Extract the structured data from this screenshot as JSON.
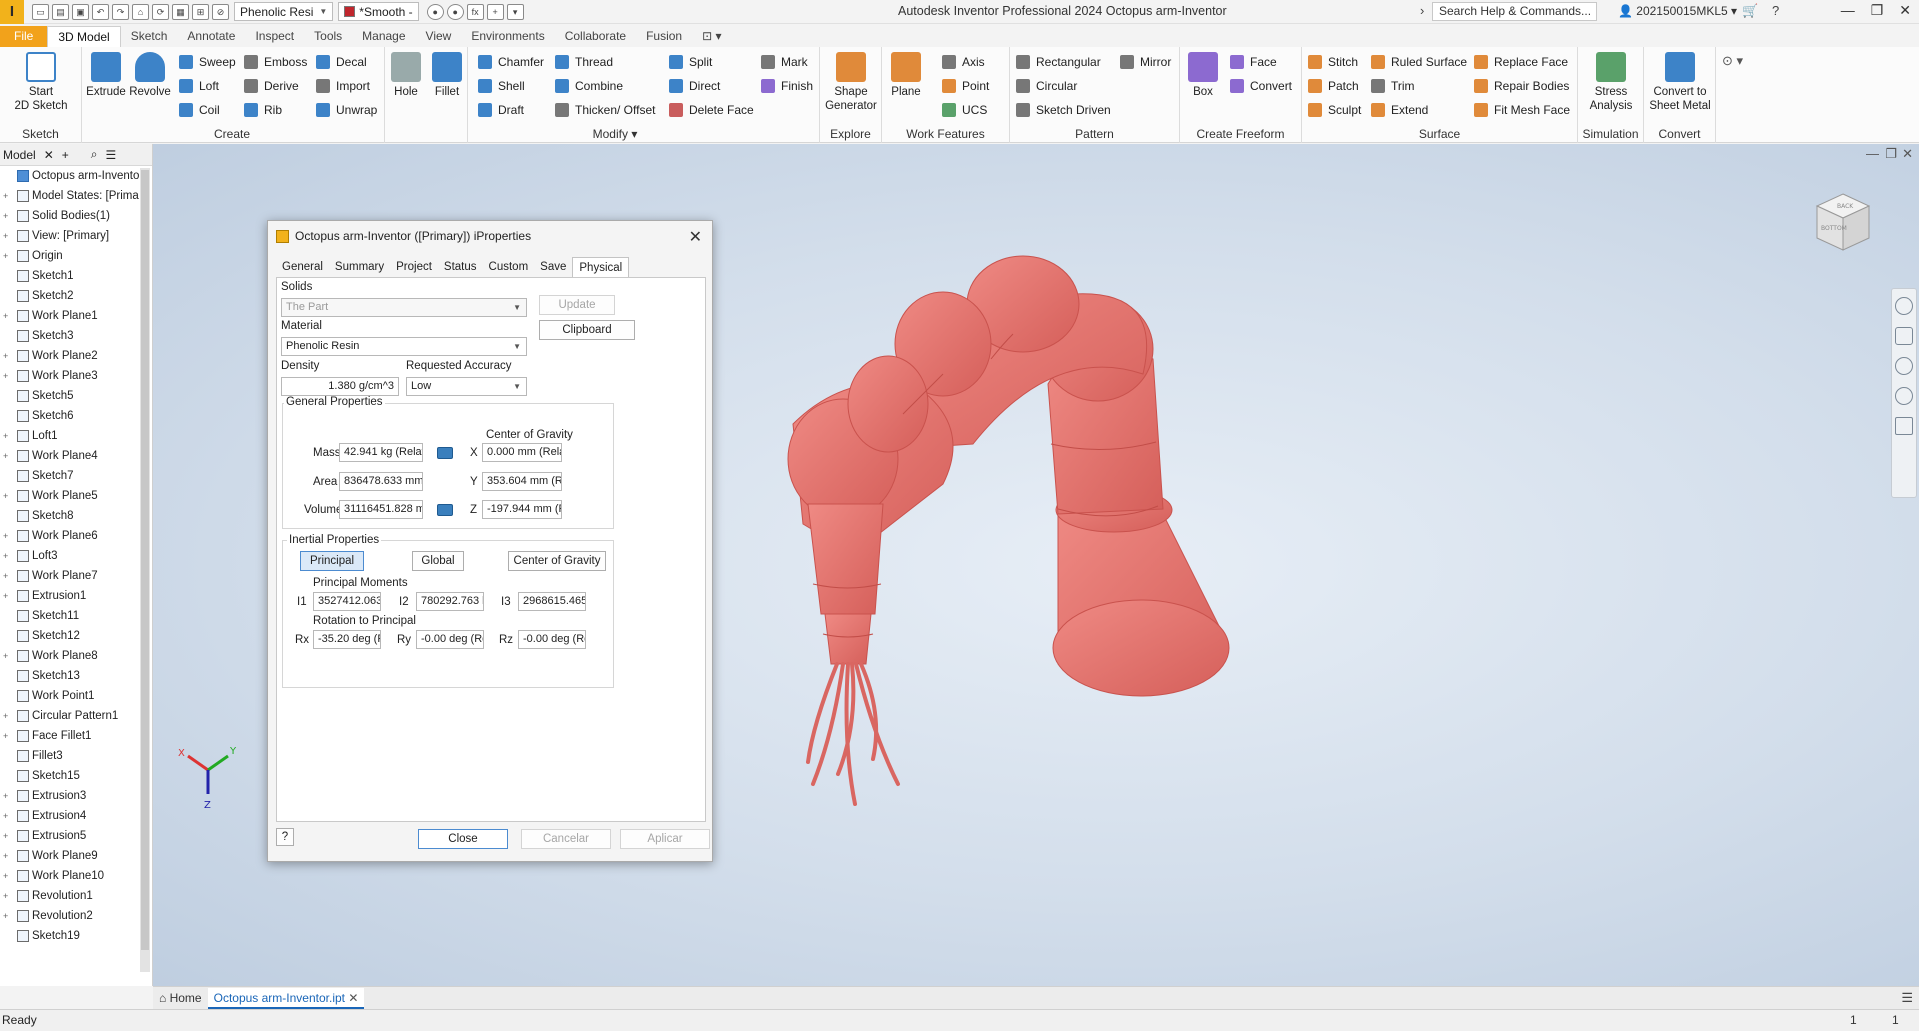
{
  "app": {
    "title": "Autodesk Inventor Professional 2024   Octopus arm-Inventor",
    "material_selector": "Phenolic Resi",
    "appearance_selector": "*Smooth -",
    "search_placeholder": "Search Help & Commands...",
    "user": "202150015MKL5",
    "accent_color": "#f2a21b"
  },
  "ribbon_tabs": [
    "File",
    "3D Model",
    "Sketch",
    "Annotate",
    "Inspect",
    "Tools",
    "Manage",
    "View",
    "Environments",
    "Collaborate",
    "Fusion"
  ],
  "ribbon": {
    "sketch": {
      "label": "Sketch",
      "start": "Start\n2D Sketch"
    },
    "create": {
      "label": "Create",
      "extrude": "Extrude",
      "revolve": "Revolve",
      "sweep": "Sweep",
      "emboss": "Emboss",
      "decal": "Decal",
      "loft": "Loft",
      "derive": "Derive",
      "import": "Import",
      "coil": "Coil",
      "rib": "Rib",
      "unwrap": "Unwrap"
    },
    "modify": {
      "label": "Modify",
      "hole": "Hole",
      "fillet": "Fillet",
      "chamfer": "Chamfer",
      "thread": "Thread",
      "split": "Split",
      "mark": "Mark",
      "shell": "Shell",
      "combine": "Combine",
      "direct": "Direct",
      "finish": "Finish",
      "draft": "Draft",
      "thicken": "Thicken/ Offset",
      "delete_face": "Delete Face"
    },
    "explore": {
      "label": "Explore",
      "shape_generator": "Shape\nGenerator"
    },
    "work_features": {
      "label": "Work Features",
      "plane": "Plane",
      "axis": "Axis",
      "point": "Point",
      "ucs": "UCS"
    },
    "pattern": {
      "label": "Pattern",
      "rectangular": "Rectangular",
      "mirror": "Mirror",
      "circular": "Circular",
      "sketch_driven": "Sketch Driven"
    },
    "freeform": {
      "label": "Create Freeform",
      "box": "Box",
      "face": "Face",
      "convert": "Convert"
    },
    "surface": {
      "label": "Surface",
      "stitch": "Stitch",
      "ruled_surface": "Ruled Surface",
      "replace_face": "Replace Face",
      "patch": "Patch",
      "trim": "Trim",
      "repair_bodies": "Repair Bodies",
      "sculpt": "Sculpt",
      "extend": "Extend",
      "fit_mesh_face": "Fit Mesh Face"
    },
    "simulation": {
      "label": "Simulation",
      "stress_analysis": "Stress\nAnalysis"
    },
    "convert": {
      "label": "Convert",
      "convert_sheet_metal": "Convert to\nSheet Metal"
    }
  },
  "browser": {
    "tab": "Model",
    "items": [
      {
        "label": "Octopus arm-Inventor"
      },
      {
        "label": "Model States: [Prima"
      },
      {
        "label": "Solid Bodies(1)"
      },
      {
        "label": "View: [Primary]"
      },
      {
        "label": "Origin"
      },
      {
        "label": "Sketch1"
      },
      {
        "label": "Sketch2"
      },
      {
        "label": "Work Plane1"
      },
      {
        "label": "Sketch3"
      },
      {
        "label": "Work Plane2"
      },
      {
        "label": "Work Plane3"
      },
      {
        "label": "Sketch5"
      },
      {
        "label": "Sketch6"
      },
      {
        "label": "Loft1"
      },
      {
        "label": "Work Plane4"
      },
      {
        "label": "Sketch7"
      },
      {
        "label": "Work Plane5"
      },
      {
        "label": "Sketch8"
      },
      {
        "label": "Work Plane6"
      },
      {
        "label": "Loft3"
      },
      {
        "label": "Work Plane7"
      },
      {
        "label": "Extrusion1"
      },
      {
        "label": "Sketch11"
      },
      {
        "label": "Sketch12"
      },
      {
        "label": "Work Plane8"
      },
      {
        "label": "Sketch13"
      },
      {
        "label": "Work Point1"
      },
      {
        "label": "Circular Pattern1"
      },
      {
        "label": "Face Fillet1"
      },
      {
        "label": "Fillet3"
      },
      {
        "label": "Sketch15"
      },
      {
        "label": "Extrusion3"
      },
      {
        "label": "Extrusion4"
      },
      {
        "label": "Extrusion5"
      },
      {
        "label": "Work Plane9"
      },
      {
        "label": "Work Plane10"
      },
      {
        "label": "Revolution1"
      },
      {
        "label": "Revolution2"
      },
      {
        "label": "Sketch19"
      }
    ]
  },
  "dialog": {
    "title": "Octopus arm-Inventor ([Primary]) iProperties",
    "tabs": [
      "General",
      "Summary",
      "Project",
      "Status",
      "Custom",
      "Save",
      "Physical"
    ],
    "solids_label": "Solids",
    "solids_value": "The Part",
    "update_btn": "Update",
    "clipboard_btn": "Clipboard",
    "material_label": "Material",
    "material_value": "Phenolic Resin",
    "density_label": "Density",
    "density_value": "1.380 g/cm^3",
    "accuracy_label": "Requested Accuracy",
    "accuracy_value": "Low",
    "general_props_label": "General Properties",
    "cog_label": "Center of Gravity",
    "mass_label": "Mass",
    "mass_value": "42.941 kg (Relative",
    "area_label": "Area",
    "area_value": "836478.633 mm^2",
    "volume_label": "Volume",
    "volume_value": "31116451.828 mm·",
    "x_label": "X",
    "x_value": "0.000 mm (Relative",
    "y_label": "Y",
    "y_value": "353.604 mm (Relati",
    "z_label": "Z",
    "z_value": "-197.944 mm (Rela",
    "inertial_label": "Inertial Properties",
    "principal_btn": "Principal",
    "global_btn": "Global",
    "cog_btn": "Center of Gravity",
    "principal_moments_label": "Principal Moments",
    "i1_label": "I1",
    "i1_value": "3527412.063 kg",
    "i2_label": "I2",
    "i2_value": "780292.763 kg",
    "i3_label": "I3",
    "i3_value": "2968615.465 kg",
    "rotation_label": "Rotation to Principal",
    "rx_label": "Rx",
    "rx_value": "-35.20 deg (Rel",
    "ry_label": "Ry",
    "ry_value": "-0.00 deg (Rela",
    "rz_label": "Rz",
    "rz_value": "-0.00 deg (Rela",
    "close_btn": "Close",
    "cancel_btn": "Cancelar",
    "apply_btn": "Aplicar",
    "help_icon": "question-icon"
  },
  "viewcube": {
    "top_label": "BACK",
    "front_label": "BOTTOM"
  },
  "model_color": "#e2726d",
  "doc_tabs": {
    "home": "Home",
    "file": "Octopus arm-Inventor.ipt"
  },
  "status": {
    "text": "Ready",
    "num1": "1",
    "num2": "1"
  },
  "triad": {
    "x": "X",
    "y": "Y",
    "z": "Z"
  }
}
